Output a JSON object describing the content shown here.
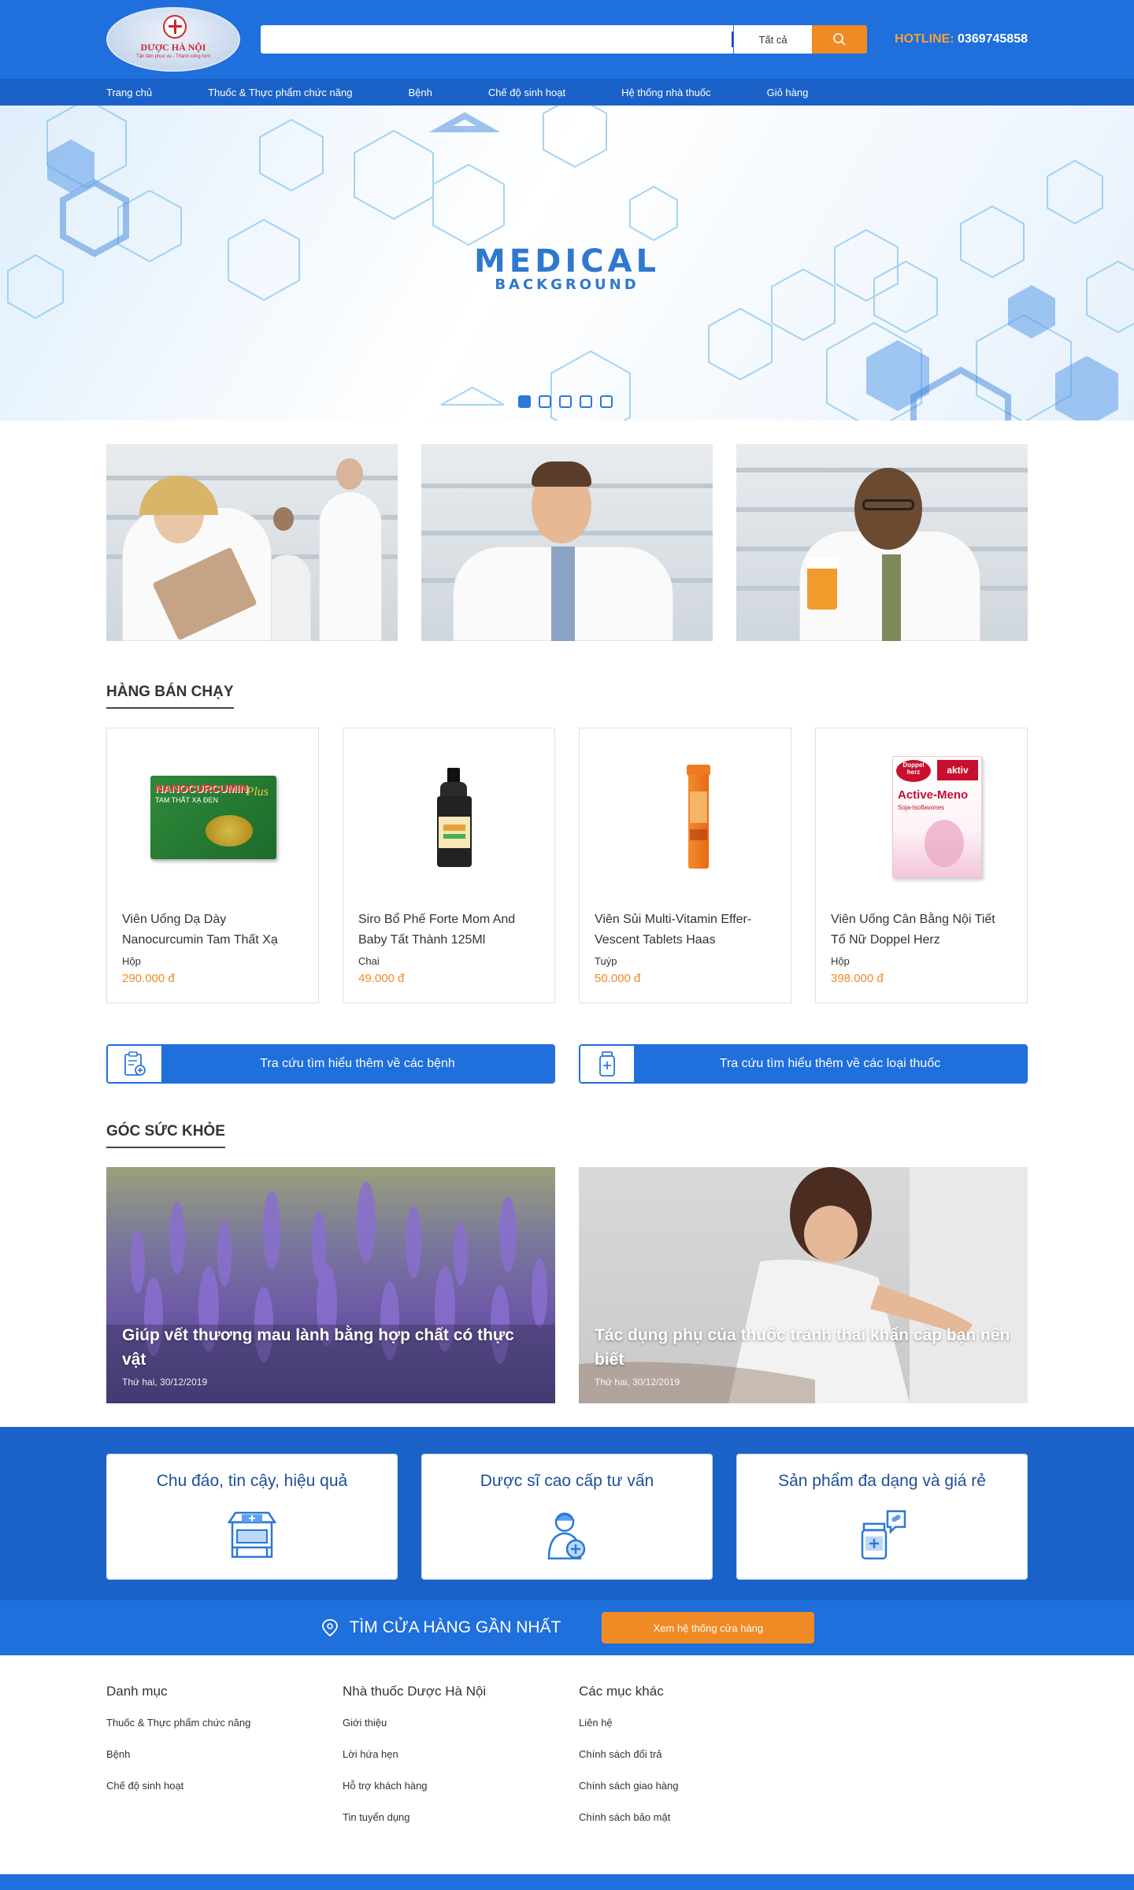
{
  "header": {
    "logo_name": "DƯỢC HÀ NỘI",
    "logo_tagline": "Tận tâm phục vụ - Thành công hơn",
    "search_placeholder": "",
    "search_category": "Tất cả",
    "hotline_label": "HOTLINE:",
    "hotline_number": "0369745858"
  },
  "nav": {
    "items": [
      {
        "label": "Trang chủ"
      },
      {
        "label": "Thuốc & Thực phẩm chức năng"
      },
      {
        "label": "Bệnh"
      },
      {
        "label": "Chế độ sinh hoạt"
      },
      {
        "label": "Hệ thống nhà thuốc"
      },
      {
        "label": "Giỏ hàng"
      }
    ]
  },
  "banner": {
    "title": "MEDICAL",
    "subtitle": "BACKGROUND",
    "slides": 5,
    "active_slide": 1
  },
  "bestsellers": {
    "title": "HÀNG BÁN CHẠY",
    "products": [
      {
        "name": "Viên Uống Dạ Dày Nanocurcumin Tam Thất Xạ",
        "unit": "Hộp",
        "price": "290.000 đ",
        "box_text": "NANOCURCUMIN",
        "box_sub": "TAM THẤT XẠ ĐEN",
        "box_plus": "Plus"
      },
      {
        "name": "Siro Bổ Phế Forte Mom And Baby Tất Thành 125Ml",
        "unit": "Chai",
        "price": "49.000 đ"
      },
      {
        "name": "Viên Sủi Multi-Vitamin Effer-Vescent Tablets Haas",
        "unit": "Tuýp",
        "price": "50.000 đ"
      },
      {
        "name": "Viên Uống Cân Bằng Nội Tiết Tố Nữ Doppel Herz",
        "unit": "Hộp",
        "price": "398.000 đ",
        "box_brand": "Doppel herz",
        "box_tag": "aktiv",
        "box_title": "Active-Meno",
        "box_sub": "Soja-Isoflavones"
      }
    ]
  },
  "lookups": {
    "diseases": "Tra cứu tìm hiểu thêm về các bệnh",
    "medicines": "Tra cứu tìm hiểu thêm về các loại thuốc"
  },
  "health": {
    "title": "GÓC SỨC KHỎE",
    "articles": [
      {
        "title": "Giúp vết thương mau lành bằng hợp chất có thực vật",
        "date": "Thứ hai, 30/12/2019"
      },
      {
        "title": "Tác dụng phụ của thuốc tránh thai khẩn cấp bạn nên biết",
        "date": "Thứ hai, 30/12/2019"
      }
    ]
  },
  "features": [
    {
      "title": "Chu đáo, tin cậy, hiệu quả",
      "icon": "pharmacy-store-icon"
    },
    {
      "title": "Dược sĩ cao cấp tư vấn",
      "icon": "pharmacist-icon"
    },
    {
      "title": "Sản phẩm đa dạng và giá rẻ",
      "icon": "medicine-bottle-icon"
    }
  ],
  "finder": {
    "title": "TÌM CỬA HÀNG GẦN NHẤT",
    "button": "Xem hệ thống cửa hàng"
  },
  "footer": {
    "columns": [
      {
        "title": "Danh mục",
        "links": [
          "Thuốc & Thực phẩm chức năng",
          "Bệnh",
          "Chế độ sinh hoạt"
        ]
      },
      {
        "title": "Nhà thuốc Dược Hà Nội",
        "links": [
          "Giới thiệu",
          "Lời hứa hẹn",
          "Hỗ trợ khách hàng",
          "Tin tuyển dụng"
        ]
      },
      {
        "title": "Các mục khác",
        "links": [
          "Liên hệ",
          "Chính sách đổi trả",
          "Chính sách giao hàng",
          "Chính sách bảo mật"
        ]
      }
    ]
  },
  "colors": {
    "primary": "#1f6fdc",
    "nav": "#1a62c7",
    "accent": "#f08a24"
  }
}
